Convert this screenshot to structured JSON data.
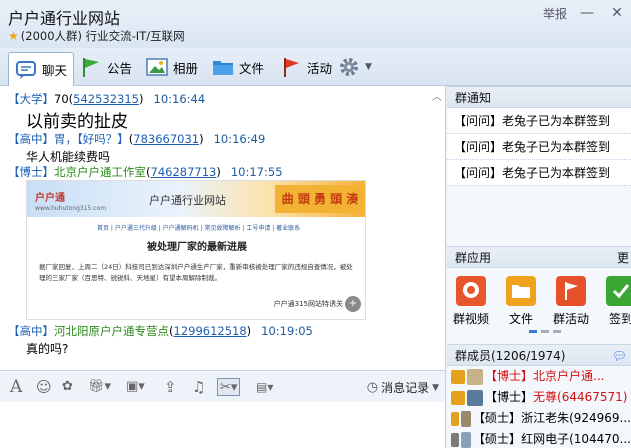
{
  "window": {
    "title": "户户通行业网站",
    "subtitle": "(2000人群) 行业交流-IT/互联网",
    "report_label": "举报",
    "minimize": "—",
    "close": "✕"
  },
  "toolbar": {
    "tabs": [
      {
        "label": "聊天",
        "active": true
      },
      {
        "label": "公告"
      },
      {
        "label": "相册"
      },
      {
        "label": "文件"
      },
      {
        "label": "活动"
      }
    ]
  },
  "chat": {
    "messages": [
      {
        "role": "【大学】",
        "name": "70",
        "qq": "542532315",
        "time": "10:16:44",
        "body": "以前卖的扯皮"
      },
      {
        "role": "【高中】",
        "name": "胃，【好吗？】",
        "qq": "783667031",
        "time": "10:16:49",
        "body": "华人机能续费吗"
      },
      {
        "role": "【博士】",
        "name": "北京户户通工作室",
        "qq": "746287713",
        "time": "10:17:55"
      },
      {
        "role": "【高中】",
        "name": "河北阳原户户通专营点",
        "qq": "1299612518",
        "time": "10:19:05",
        "body": "真的吗?"
      }
    ],
    "ad": {
      "logo": "户户通",
      "domain": "www.huhutong315.com",
      "site_title": "户户通行业网站",
      "deco": "曲 頭 勇 頭 湊",
      "nav": "首页 | 户户通三代升级 | 户户通解码机 | 常见故障解析 | 工号申请 | 著业联系",
      "headline": "被处理厂家的最新进展",
      "paragraph": "据厂家回复，上周二（24日）科技司已到达深圳户户通生产厂家，重新审核被处理厂家的违规自查情况，被处理的三家厂家（百思特、锐锐科、天地星）有望本周解除制裁。",
      "source": "户户通315网站特诱关"
    }
  },
  "input_bar": {
    "history_label": "消息记录"
  },
  "right": {
    "notice_title": "群通知",
    "notices": [
      "【问问】老兔子已为本群签到",
      "【问问】老兔子已为本群签到",
      "【问问】老兔子已为本群签到"
    ],
    "apps_title": "群应用",
    "apps_more": "更",
    "apps": [
      {
        "label": "群视频",
        "color": "#e8572b"
      },
      {
        "label": "文件",
        "color": "#f0a21e"
      },
      {
        "label": "群活动",
        "color": "#e6502b"
      },
      {
        "label": "签到",
        "color": "#3aa634"
      }
    ],
    "members_title": "群成员(1206/1974)",
    "members": [
      {
        "role": "【博士】",
        "name": "北京户户通...",
        "red": true,
        "icon_color": "#e5a11c"
      },
      {
        "role": "【博士】",
        "name": "无尊(64467571)",
        "red": true,
        "icon_color": "#e5a11c"
      },
      {
        "role": "【硕士】",
        "name": "浙江老朱(924969...",
        "red": false,
        "icon_color": "#e5a11c"
      },
      {
        "role": "【硕士】",
        "name": "红网电子(104470...",
        "red": false,
        "icon_color": "#7a7a7a"
      }
    ]
  }
}
